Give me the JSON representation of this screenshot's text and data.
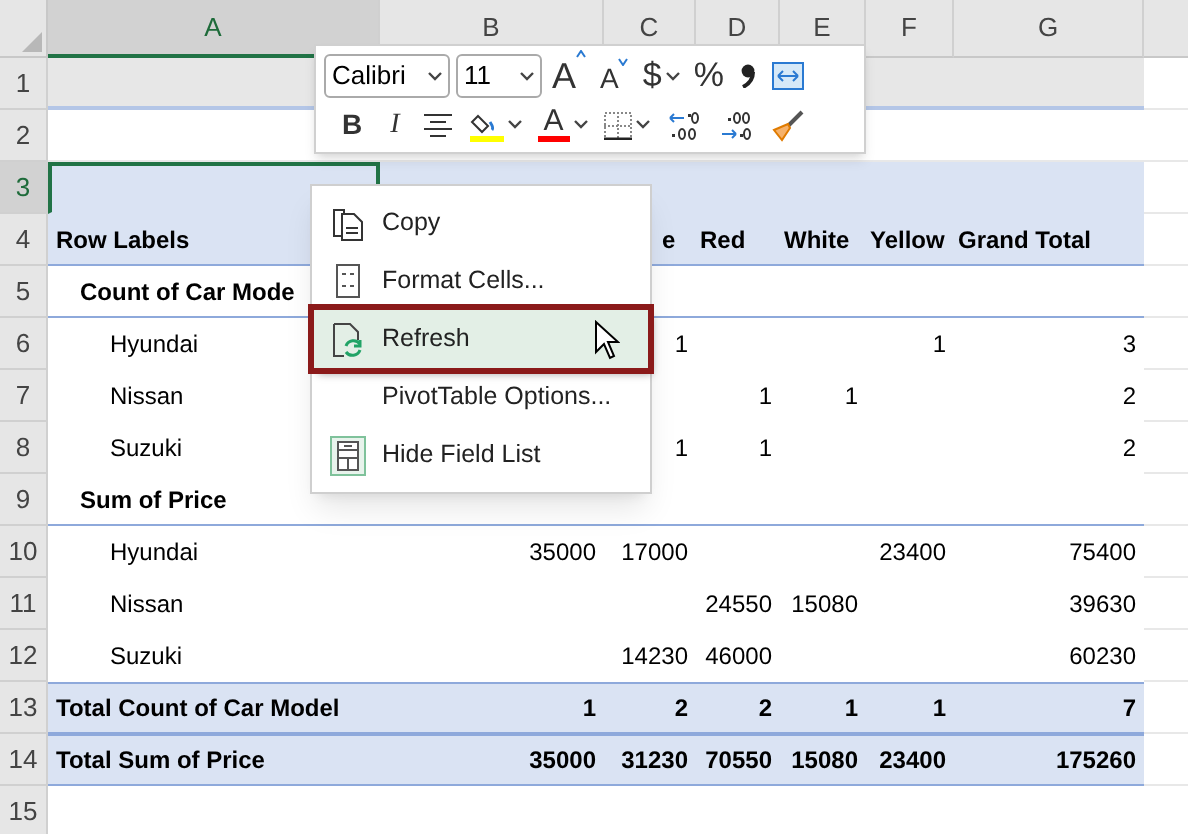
{
  "column_headers": [
    {
      "label": "A",
      "selected": true
    },
    {
      "label": "B",
      "selected": false
    },
    {
      "label": "C",
      "selected": false
    },
    {
      "label": "D",
      "selected": false
    },
    {
      "label": "E",
      "selected": false
    },
    {
      "label": "F",
      "selected": false
    },
    {
      "label": "G",
      "selected": false
    }
  ],
  "rows": [
    {
      "number": "1",
      "kind": "gray",
      "selected": false,
      "cells": [
        null,
        null,
        null,
        null,
        null,
        null,
        null
      ]
    },
    {
      "number": "2",
      "kind": "blank",
      "selected": false,
      "cells": [
        null,
        null,
        null,
        null,
        null,
        null,
        null
      ]
    },
    {
      "number": "3",
      "kind": "band",
      "selected": true,
      "cells": [
        null,
        null,
        null,
        null,
        null,
        null,
        null
      ]
    },
    {
      "number": "4",
      "kind": "header",
      "selected": false,
      "cells": [
        "Row Labels",
        null,
        "e",
        "Red",
        "White",
        "Yellow",
        "Grand Total"
      ]
    },
    {
      "number": "5",
      "kind": "group",
      "selected": false,
      "cells": [
        "Count of Car Mode",
        null,
        null,
        null,
        null,
        null,
        null
      ]
    },
    {
      "number": "6",
      "kind": "item",
      "selected": false,
      "cells": [
        "Hyundai",
        null,
        "1",
        null,
        null,
        "1",
        "3"
      ]
    },
    {
      "number": "7",
      "kind": "item",
      "selected": false,
      "cells": [
        "Nissan",
        null,
        null,
        "1",
        "1",
        null,
        "2"
      ]
    },
    {
      "number": "8",
      "kind": "item",
      "selected": false,
      "cells": [
        "Suzuki",
        null,
        "1",
        "1",
        null,
        null,
        "2"
      ]
    },
    {
      "number": "9",
      "kind": "group",
      "selected": false,
      "cells": [
        "Sum of Price",
        null,
        null,
        null,
        null,
        null,
        null
      ]
    },
    {
      "number": "10",
      "kind": "item",
      "selected": false,
      "cells": [
        "Hyundai",
        "35000",
        "17000",
        null,
        null,
        "23400",
        "75400"
      ]
    },
    {
      "number": "11",
      "kind": "item",
      "selected": false,
      "cells": [
        "Nissan",
        null,
        null,
        "24550",
        "15080",
        null,
        "39630"
      ]
    },
    {
      "number": "12",
      "kind": "item",
      "selected": false,
      "cells": [
        "Suzuki",
        null,
        "14230",
        "46000",
        null,
        null,
        "60230"
      ]
    },
    {
      "number": "13",
      "kind": "total",
      "selected": false,
      "cells": [
        "Total Count of Car Model",
        "1",
        "2",
        "2",
        "1",
        "1",
        "7"
      ]
    },
    {
      "number": "14",
      "kind": "total",
      "selected": false,
      "cells": [
        "Total Sum of Price",
        "35000",
        "31230",
        "70550",
        "15080",
        "23400",
        "175260"
      ]
    },
    {
      "number": "15",
      "kind": "blank",
      "selected": false,
      "cells": [
        null,
        null,
        null,
        null,
        null,
        null,
        null
      ]
    }
  ],
  "mini_toolbar": {
    "font": "Calibri",
    "size": "11",
    "row_1": [
      {
        "kind": "grow",
        "text": "A"
      },
      {
        "kind": "shrink",
        "text": "A"
      },
      {
        "kind": "glyph",
        "text": "$",
        "dropdown": true
      },
      {
        "kind": "glyph",
        "text": "%",
        "dropdown": false
      },
      {
        "kind": "comma"
      },
      {
        "kind": "wrap"
      }
    ],
    "row_2": [
      {
        "kind": "bold",
        "text": "B"
      },
      {
        "kind": "italic",
        "text": "I"
      },
      {
        "kind": "align"
      },
      {
        "kind": "fill",
        "color": "#ffff00"
      },
      {
        "kind": "fontcolor",
        "text": "A",
        "color": "#ff0000"
      },
      {
        "kind": "borders"
      },
      {
        "kind": "incdec"
      },
      {
        "kind": "decdec"
      },
      {
        "kind": "painter"
      }
    ]
  },
  "context_menu": [
    {
      "label": "Copy",
      "kind": "copy",
      "selected": false
    },
    {
      "label": "Format Cells...",
      "kind": "format",
      "selected": false
    },
    {
      "label": "Refresh",
      "kind": "refresh",
      "selected": true
    },
    {
      "label": "PivotTable Options...",
      "kind": "plain",
      "selected": false
    },
    {
      "label": "Hide Field List",
      "kind": "fieldlist",
      "selected": false
    }
  ]
}
